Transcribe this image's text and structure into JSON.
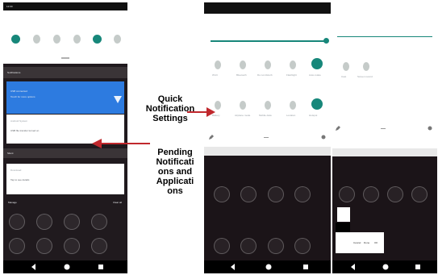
{
  "annotations": {
    "quick_label": "Quick\nNotification\nSettings",
    "pending_label": "Pending\nNotificati\nons and\nApplicati\nons"
  },
  "colors": {
    "arrow": "#c0282d",
    "teal": "#17877a",
    "blue_card": "#2d7be0",
    "dark_bg": "#1b1418"
  },
  "phone1": {
    "status_time": "12:00",
    "quick_icons": [
      "wifi-icon",
      "bluetooth-icon",
      "dnd-icon",
      "flashlight-icon",
      "rotate-icon",
      "battery-icon"
    ],
    "section1": "Notifications",
    "card_title": "USB connected",
    "card_sub": "Touch for more options",
    "notif2_title": "Android System",
    "notif2_sub": "USB file transfer turned on",
    "section2": "Silent",
    "notif3_title": "Download",
    "notif3_sub": "Tap to see details",
    "left_btn": "Manage",
    "right_btn": "Clear all"
  },
  "phone2": {
    "tiles_row1": [
      "Wi-Fi",
      "Bluetooth",
      "Do not disturb",
      "Flashlight",
      "Auto-rotate"
    ],
    "tiles_row2": [
      "Battery",
      "Airplane mode",
      "Mobile data",
      "Location",
      "Hotspot"
    ],
    "edit_icon": "pencil-icon",
    "settings_icon": "gear-icon"
  },
  "phone3": {
    "tiles_row1": [
      "Cast",
      "Screen record"
    ],
    "edit_icon": "pencil-icon",
    "settings_icon": "gear-icon",
    "dialog_left": "Cancel",
    "dialog_mid": "Done",
    "dialog_right": "OK"
  }
}
